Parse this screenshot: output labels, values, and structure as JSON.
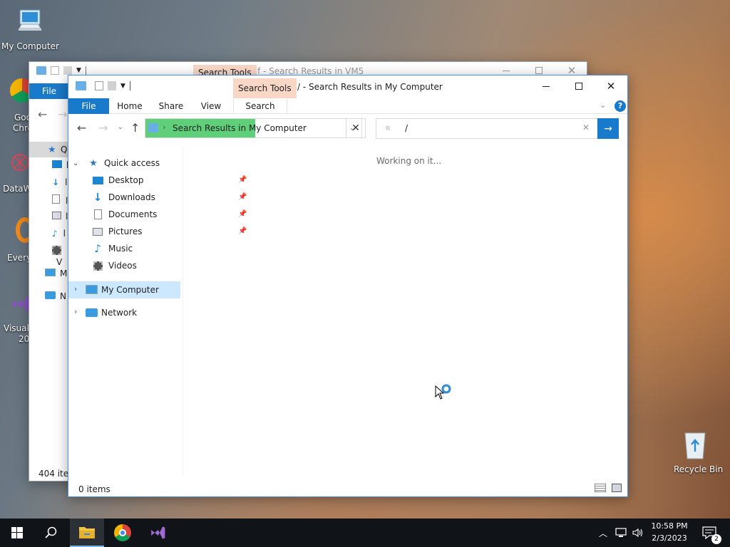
{
  "desktop": {
    "icons": {
      "my_computer": "My Computer",
      "recycle_bin": "Recycle Bin",
      "chrome_partial": "Goo\nChro",
      "datawiz_partial": "DataW",
      "everything_partial": "Every",
      "vs_partial_1": "Visual",
      "vs_partial_2": "20"
    }
  },
  "back_window": {
    "title": "f - Search Results in VM5",
    "context_tab": "Search Tools",
    "file_tab": "File",
    "status": "404 item",
    "nav_partial": [
      "Q",
      "l",
      "l",
      "l",
      "l",
      "l",
      "V",
      "M",
      "N"
    ]
  },
  "front_window": {
    "title": "/ - Search Results in My Computer",
    "context_tab": "Search Tools",
    "ribbon_tabs": {
      "file": "File",
      "home": "Home",
      "share": "Share",
      "view": "View",
      "search": "Search"
    },
    "address": {
      "path": "Search Results in My Computer"
    },
    "search": {
      "value": "/"
    },
    "content_message": "Working on it...",
    "status": "0 items",
    "nav": {
      "quick_access": "Quick access",
      "desktop": "Desktop",
      "downloads": "Downloads",
      "documents": "Documents",
      "pictures": "Pictures",
      "music": "Music",
      "videos": "Videos",
      "my_computer": "My Computer",
      "network": "Network"
    }
  },
  "taskbar": {
    "time": "10:58 PM",
    "date": "2/3/2023",
    "notification_count": "2"
  },
  "colors": {
    "accent": "#1979ca",
    "search_tools_bg": "#f8d7c6",
    "address_highlight": "#5fcf7a",
    "selection": "#cce8ff"
  },
  "icons": [
    "windows-start-icon",
    "search-icon",
    "file-explorer-icon",
    "chrome-icon",
    "visual-studio-icon",
    "chevron-up-icon",
    "network-icon",
    "volume-icon",
    "action-center-icon"
  ]
}
